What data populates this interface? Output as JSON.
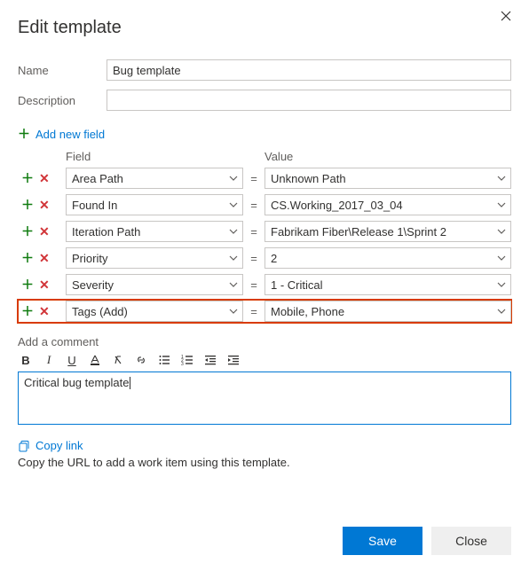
{
  "title": "Edit template",
  "form": {
    "name_label": "Name",
    "name_value": "Bug template",
    "desc_label": "Description",
    "desc_value": ""
  },
  "add_new_label": "Add new field",
  "grid": {
    "field_header": "Field",
    "value_header": "Value",
    "eq": "=",
    "rows": [
      {
        "field": "Area Path",
        "value": "Unknown Path"
      },
      {
        "field": "Found In",
        "value": "CS.Working_2017_03_04"
      },
      {
        "field": "Iteration Path",
        "value": "Fabrikam Fiber\\Release 1\\Sprint 2"
      },
      {
        "field": "Priority",
        "value": "2"
      },
      {
        "field": "Severity",
        "value": "1 - Critical"
      },
      {
        "field": "Tags (Add)",
        "value": "Mobile, Phone"
      }
    ]
  },
  "comment": {
    "label": "Add a comment",
    "text": "Critical bug template"
  },
  "copy": {
    "link_label": "Copy link",
    "hint": "Copy the URL to add a work item using this template."
  },
  "buttons": {
    "save": "Save",
    "close": "Close"
  }
}
